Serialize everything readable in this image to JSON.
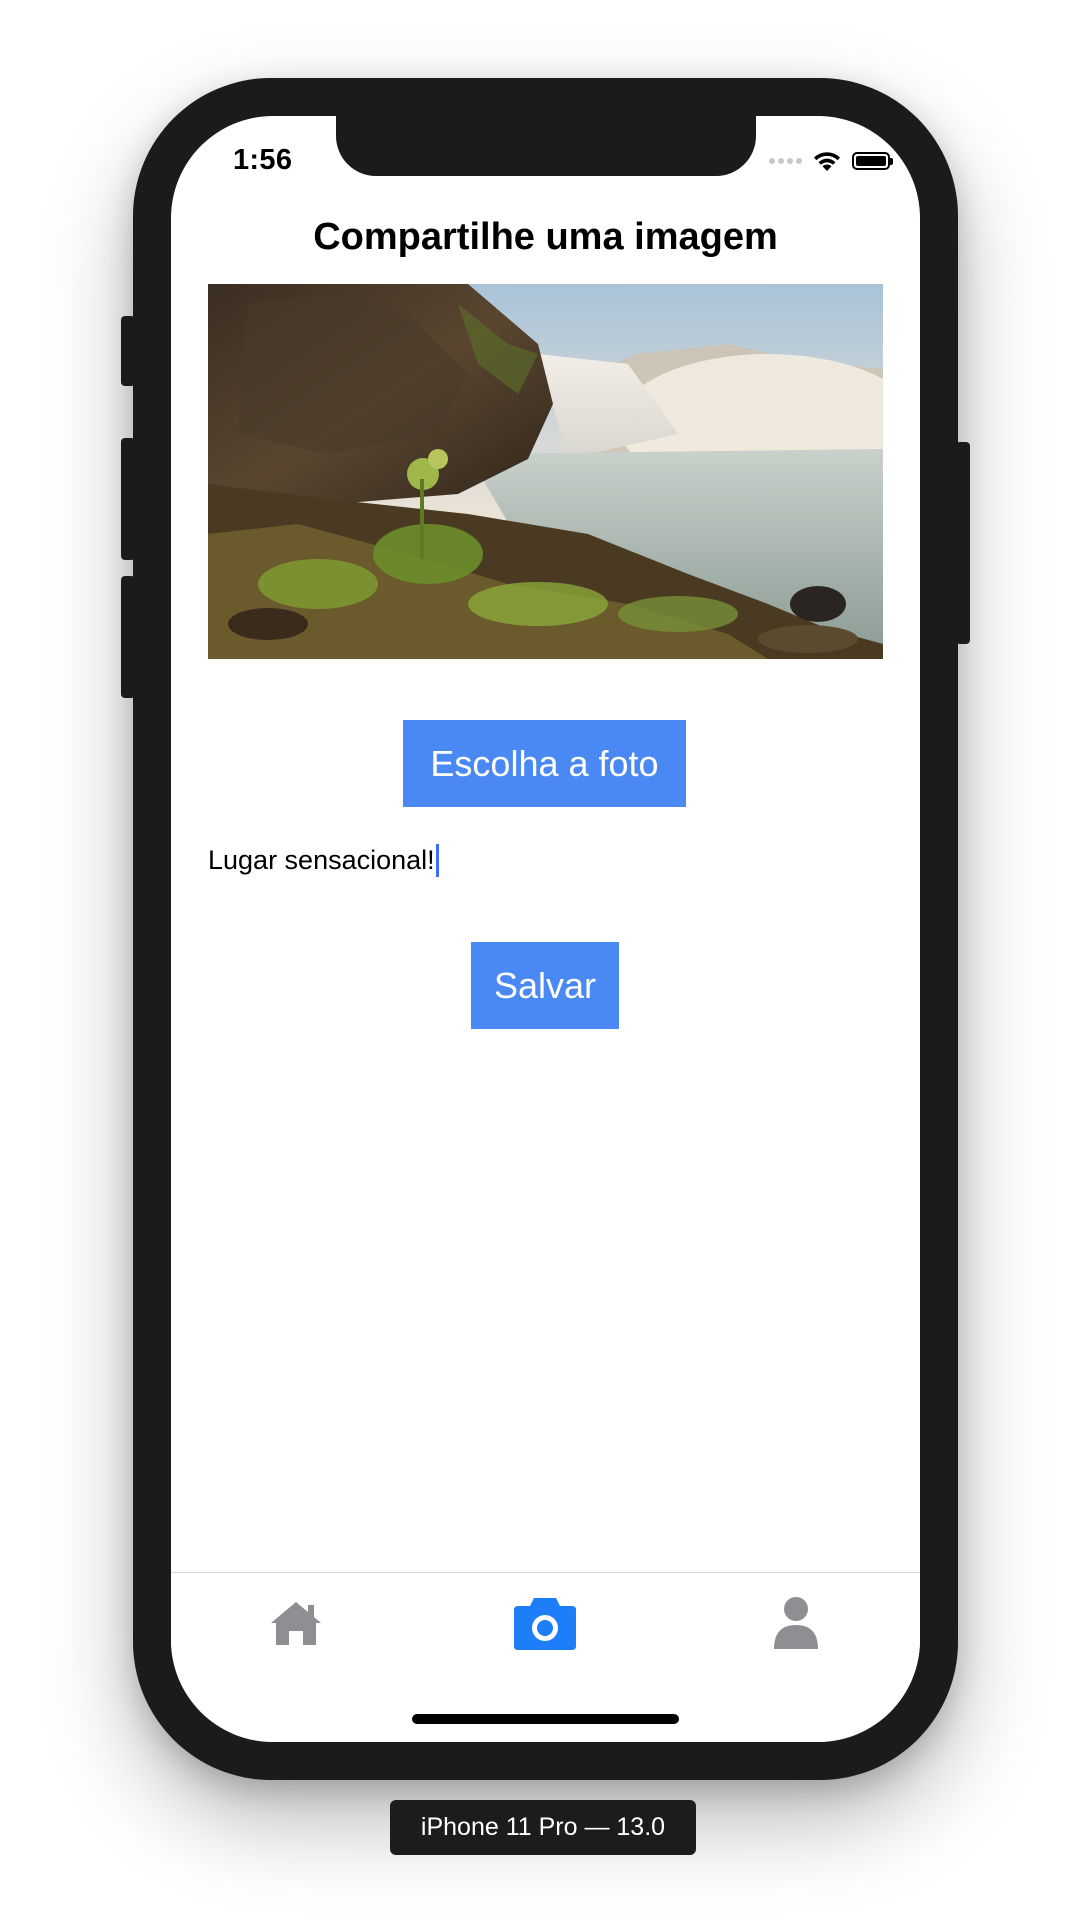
{
  "status_bar": {
    "time": "1:56",
    "icons": [
      "signal-dots-icon",
      "wifi-icon",
      "battery-icon"
    ]
  },
  "screen": {
    "title": "Compartilhe uma imagem",
    "image": "waterfall-landscape-photo",
    "choose_button_label": "Escolha a foto",
    "caption_value": "Lugar sensacional!",
    "save_button_label": "Salvar"
  },
  "tabbar": {
    "items": [
      {
        "icon": "home-icon",
        "active": false
      },
      {
        "icon": "camera-icon",
        "active": true
      },
      {
        "icon": "user-icon",
        "active": false
      }
    ],
    "active_color": "#1e7ef7",
    "inactive_color": "#8e8e93"
  },
  "colors": {
    "button": "#4a89f3",
    "button_text": "#ffffff",
    "caret": "#3b6ef5",
    "device_frame": "#1b1b1d"
  },
  "device_label": "iPhone 11 Pro — 13.0"
}
